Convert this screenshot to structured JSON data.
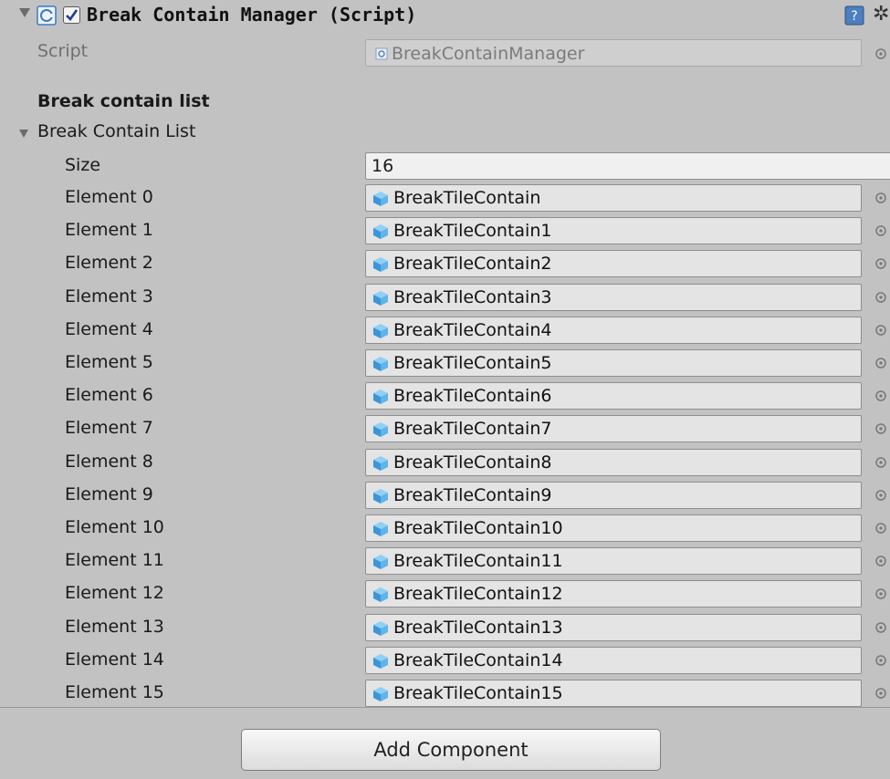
{
  "component": {
    "title": "Break Contain Manager (Script)",
    "enabled": true
  },
  "script_field": {
    "label": "Script",
    "value": "BreakContainManager"
  },
  "section_header": "Break contain list",
  "list": {
    "label": "Break Contain List",
    "size_label": "Size",
    "size_value": "16",
    "elements": [
      {
        "label": "Element 0",
        "value": "BreakTileContain"
      },
      {
        "label": "Element 1",
        "value": "BreakTileContain1"
      },
      {
        "label": "Element 2",
        "value": "BreakTileContain2"
      },
      {
        "label": "Element 3",
        "value": "BreakTileContain3"
      },
      {
        "label": "Element 4",
        "value": "BreakTileContain4"
      },
      {
        "label": "Element 5",
        "value": "BreakTileContain5"
      },
      {
        "label": "Element 6",
        "value": "BreakTileContain6"
      },
      {
        "label": "Element 7",
        "value": "BreakTileContain7"
      },
      {
        "label": "Element 8",
        "value": "BreakTileContain8"
      },
      {
        "label": "Element 9",
        "value": "BreakTileContain9"
      },
      {
        "label": "Element 10",
        "value": "BreakTileContain10"
      },
      {
        "label": "Element 11",
        "value": "BreakTileContain11"
      },
      {
        "label": "Element 12",
        "value": "BreakTileContain12"
      },
      {
        "label": "Element 13",
        "value": "BreakTileContain13"
      },
      {
        "label": "Element 14",
        "value": "BreakTileContain14"
      },
      {
        "label": "Element 15",
        "value": "BreakTileContain15"
      }
    ]
  },
  "add_component_label": "Add Component",
  "colors": {
    "panel": "#c2c2c2",
    "cube": "#4aa3df",
    "script_icon": "#3a7bc8"
  },
  "icons": [
    "foldout-arrow-icon",
    "csharp-script-icon",
    "checkbox-icon",
    "help-icon",
    "gear-icon",
    "object-picker-icon",
    "prefab-cube-icon"
  ]
}
